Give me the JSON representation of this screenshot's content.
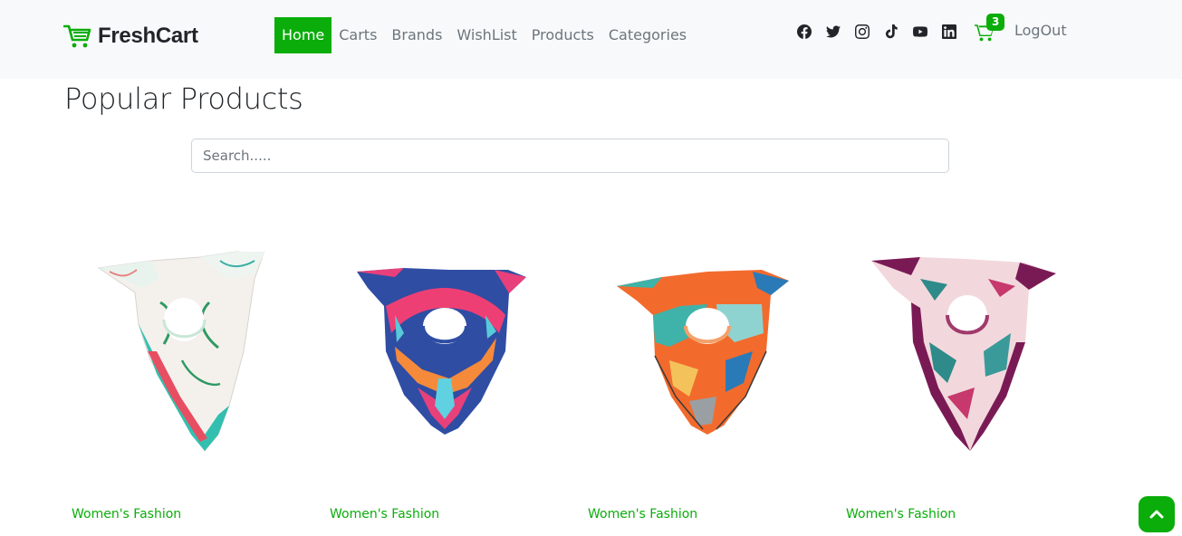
{
  "brand": {
    "name": "FreshCart",
    "logo_icon": "cart-logo-icon"
  },
  "nav": {
    "links": [
      {
        "label": "Home",
        "active": true
      },
      {
        "label": "Carts",
        "active": false
      },
      {
        "label": "Brands",
        "active": false
      },
      {
        "label": "WishList",
        "active": false
      },
      {
        "label": "Products",
        "active": false
      },
      {
        "label": "Categories",
        "active": false
      }
    ]
  },
  "social": [
    "facebook-icon",
    "twitter-icon",
    "instagram-icon",
    "tiktok-icon",
    "youtube-icon",
    "linkedin-icon"
  ],
  "cart": {
    "count": "3",
    "icon": "shopping-cart-icon"
  },
  "logout_label": "LogOut",
  "page_title": "Popular Products",
  "search": {
    "placeholder": "Search.....",
    "value": ""
  },
  "products": [
    {
      "category": "Women's Fashion",
      "image": "white-green-floral-scarf"
    },
    {
      "category": "Women's Fashion",
      "image": "blue-pink-pattern-scarf"
    },
    {
      "category": "Women's Fashion",
      "image": "orange-teal-geometric-scarf"
    },
    {
      "category": "Women's Fashion",
      "image": "purple-pink-leaf-scarf"
    }
  ],
  "colors": {
    "accent": "#0aad0a",
    "navbar_bg": "#f8f9fa",
    "muted_text": "#6c757d"
  },
  "scroll_top_icon": "chevron-up-icon"
}
